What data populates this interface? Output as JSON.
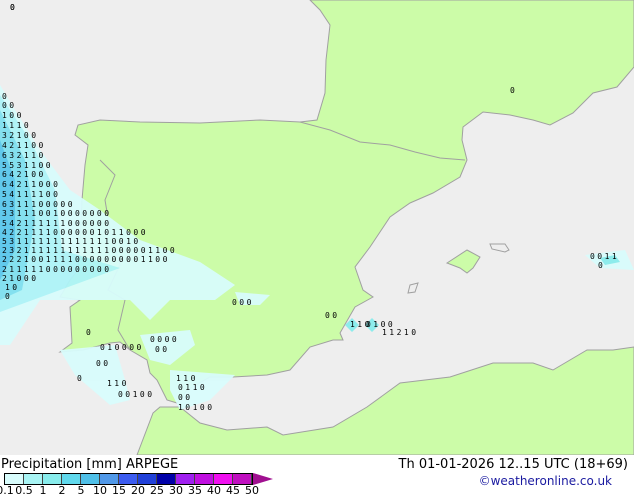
{
  "title": "Precipitation [mm]",
  "model": "ARPEGE",
  "datetime": "Th 01-01-2026 12..15 UTC (18+69)",
  "copyright": "©weatheronline.co.uk",
  "colors": {
    "sea": "#eeeeee",
    "land": "#ccfca8",
    "coast": "#a0a0a0"
  },
  "legend": {
    "ticks": [
      "0.1",
      "0.5",
      "1",
      "2",
      "5",
      "10",
      "15",
      "20",
      "25",
      "30",
      "35",
      "40",
      "45",
      "50"
    ],
    "colors": [
      "#d8fcfc",
      "#a8f4f4",
      "#88ecec",
      "#60d8ec",
      "#50c0e8",
      "#5098e8",
      "#3c5cf0",
      "#2040d8",
      "#0000a8",
      "#a020f0",
      "#c010e0",
      "#f010f0",
      "#c010c0"
    ],
    "arrow_color": "#a01090"
  },
  "map_values": [
    "0",
    "0 0",
    "1 0 0",
    "1 1 1 0",
    "3 2 1 0 0",
    "4 2 1 1 0 0",
    "6 3 2 1 1 0",
    "5 5 3 1 1 0 0",
    "6 4 2 1 0 0",
    "6 4 2 1 1 0 0 0",
    "5 4 1 1 1 1 0 0",
    "6 3 1 1 1 0 0 0 0 0",
    "3 3 1 1 1 0 0 1 0 0 0 0 0 0 0",
    "5 4 2 1 1 1 1 1 1 0 0 0 0 0 0",
    "4 2 2 1 1 1 1 0 0 0 0 0 0 1 0 1 1 0 0 0",
    "5 3 1 1 1 1 1 1 1 1 1 1 1 1 1 0 0 1 0",
    "2 3 2 1 1 1 1 1 1 1 1 1 1 1 1 0 0 0 0 0 1 1 0 0",
    "2 2 2 1 0 0 1 1 1 1 0 0 0 0 0 0 0 0 0 1 1 0 0",
    "2 1 1 1 1 1 0 0 0 0 0 0 0 0 0",
    "2 1 0 0 0",
    "1 0",
    "0",
    "0 0 0",
    "0 0 0 0",
    "0 0",
    "0 1 0 0 0 0",
    "0 0",
    "0",
    "1 1 0",
    "0 0 1 0 0",
    "1 1 0",
    "0 1 1 0",
    "0 0",
    "1 0 1 0 0",
    "1 1 0",
    "0 1 0 0",
    "1 1 2 1 0",
    "0 0 1 1",
    "0",
    "0",
    "0 0",
    "0",
    "0",
    "0"
  ]
}
